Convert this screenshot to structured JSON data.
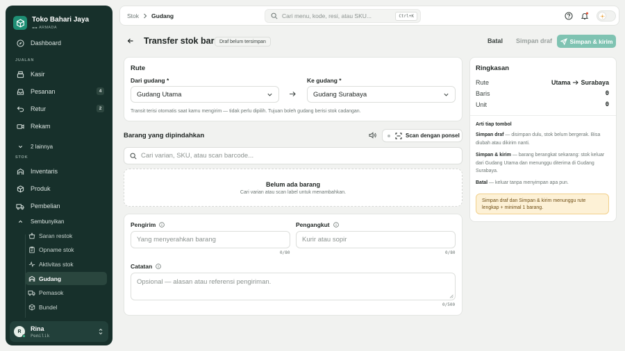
{
  "brand": {
    "name": "Toko Bahari Jaya",
    "subtitle": "ARMADA",
    "accent": "#1f8f75",
    "sidebar_bg": "#17302b"
  },
  "sidebar": {
    "dashboard": "Dashboard",
    "section_jualan": "JUALAN",
    "jualan": [
      {
        "label": "Kasir",
        "icon": "cash-register-icon"
      },
      {
        "label": "Pesanan",
        "icon": "inbox-icon",
        "badge": "4"
      },
      {
        "label": "Retur",
        "icon": "return-icon",
        "badge": "2"
      },
      {
        "label": "Rekam",
        "icon": "recording-icon"
      },
      {
        "label": "2 lainnya",
        "icon": "chevron-down-icon"
      }
    ],
    "section_stok": "STOK",
    "stok": [
      {
        "label": "Inventaris",
        "icon": "warehouse-icon"
      },
      {
        "label": "Produk",
        "icon": "box-icon"
      },
      {
        "label": "Pembelian",
        "icon": "truck-icon"
      },
      {
        "label": "Sembunyikan",
        "icon": "chevron-up-icon"
      }
    ],
    "sub": [
      {
        "label": "Saran restok",
        "icon": "basket-icon"
      },
      {
        "label": "Opname stok",
        "icon": "clipboard-icon"
      },
      {
        "label": "Aktivitas stok",
        "icon": "activity-icon"
      },
      {
        "label": "Gudang",
        "icon": "warehouse-icon",
        "active": true
      },
      {
        "label": "Pemasok",
        "icon": "truck-icon"
      },
      {
        "label": "Bundel",
        "icon": "box-icon"
      }
    ],
    "user": {
      "initial": "R",
      "name": "Rina",
      "role": "Pemilik"
    }
  },
  "topbar": {
    "crumb_root": "Stok",
    "crumb_current": "Gudang",
    "search_placeholder": "Cari menu, kode, resi, atau SKU...",
    "shortcut": "Ctrl+K"
  },
  "header": {
    "title": "Transfer stok baru",
    "status": "Draf belum tersimpan",
    "cancel": "Batal",
    "save_draft": "Simpan draf",
    "save_send": "Simpan & kirim"
  },
  "route": {
    "title": "Rute",
    "from_label": "Dari gudang",
    "to_label": "Ke gudang",
    "required": "*",
    "from_value": "Gudang Utama",
    "to_value": "Gudang Surabaya",
    "note": "Transit terisi otomatis saat kamu mengirim — tidak perlu dipilih. Tujuan boleh gudang berisi stok cadangan."
  },
  "items": {
    "title": "Barang yang dipindahkan",
    "scan_button": "Scan dengan ponsel",
    "search_placeholder": "Cari varian, SKU, atau scan barcode...",
    "empty_title": "Belum ada barang",
    "empty_sub": "Cari varian atau scan label untuk menambahkan."
  },
  "details": {
    "sender_label": "Pengirim",
    "sender_placeholder": "Yang menyerahkan barang",
    "sender_count": "0/80",
    "carrier_label": "Pengangkut",
    "carrier_placeholder": "Kurir atau sopir",
    "carrier_count": "0/80",
    "notes_label": "Catatan",
    "notes_placeholder": "Opsional — alasan atau referensi pengiriman.",
    "notes_count": "0/500"
  },
  "summary": {
    "title": "Ringkasan",
    "route_label": "Rute",
    "route_from": "Utama",
    "route_to": "Surabaya",
    "lines_label": "Baris",
    "lines_value": "0",
    "unit_label": "Unit",
    "unit_value": "0",
    "explain_title": "Arti tiap tombol",
    "draft_term": "Simpan draf",
    "draft_desc": " — disimpan dulu, stok belum bergerak. Bisa diubah atau dikirim nanti.",
    "send_term": "Simpan & kirim",
    "send_desc": " — barang berangkat sekarang: stok keluar dari Gudang Utama dan menunggu diterima di Gudang Surabaya.",
    "cancel_term": "Batal",
    "cancel_desc": " — keluar tanpa menyimpan apa pun.",
    "warning": "Simpan draf dan Simpan & kirim menunggu rute lengkap + minimal 1 barang."
  }
}
